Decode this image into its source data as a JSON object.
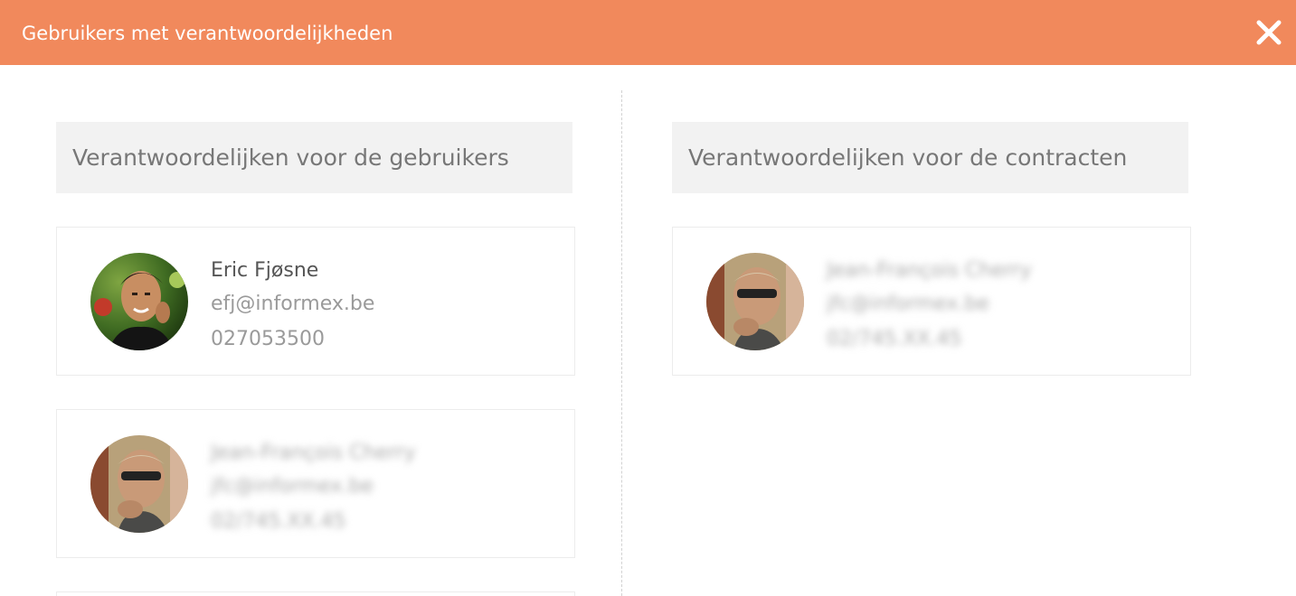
{
  "header": {
    "title": "Gebruikers met verantwoordelijkheden",
    "close_icon": "close-icon",
    "background_color": "#f1895c"
  },
  "users_section": {
    "title": "Verantwoordelijken voor de gebruikers",
    "cards": [
      {
        "name": "Eric Fjøsne",
        "email": "efj@informex.be",
        "phone": "027053500",
        "blurred": false
      },
      {
        "name": "Jean-François Cherry",
        "email": "jfc@informex.be",
        "phone": "02/745.XX.45",
        "blurred": true
      }
    ]
  },
  "contracts_section": {
    "title": "Verantwoordelijken voor de contracten",
    "cards": [
      {
        "name": "Jean-François Cherry",
        "email": "jfc@informex.be",
        "phone": "02/745.XX.45",
        "blurred": true
      }
    ]
  }
}
